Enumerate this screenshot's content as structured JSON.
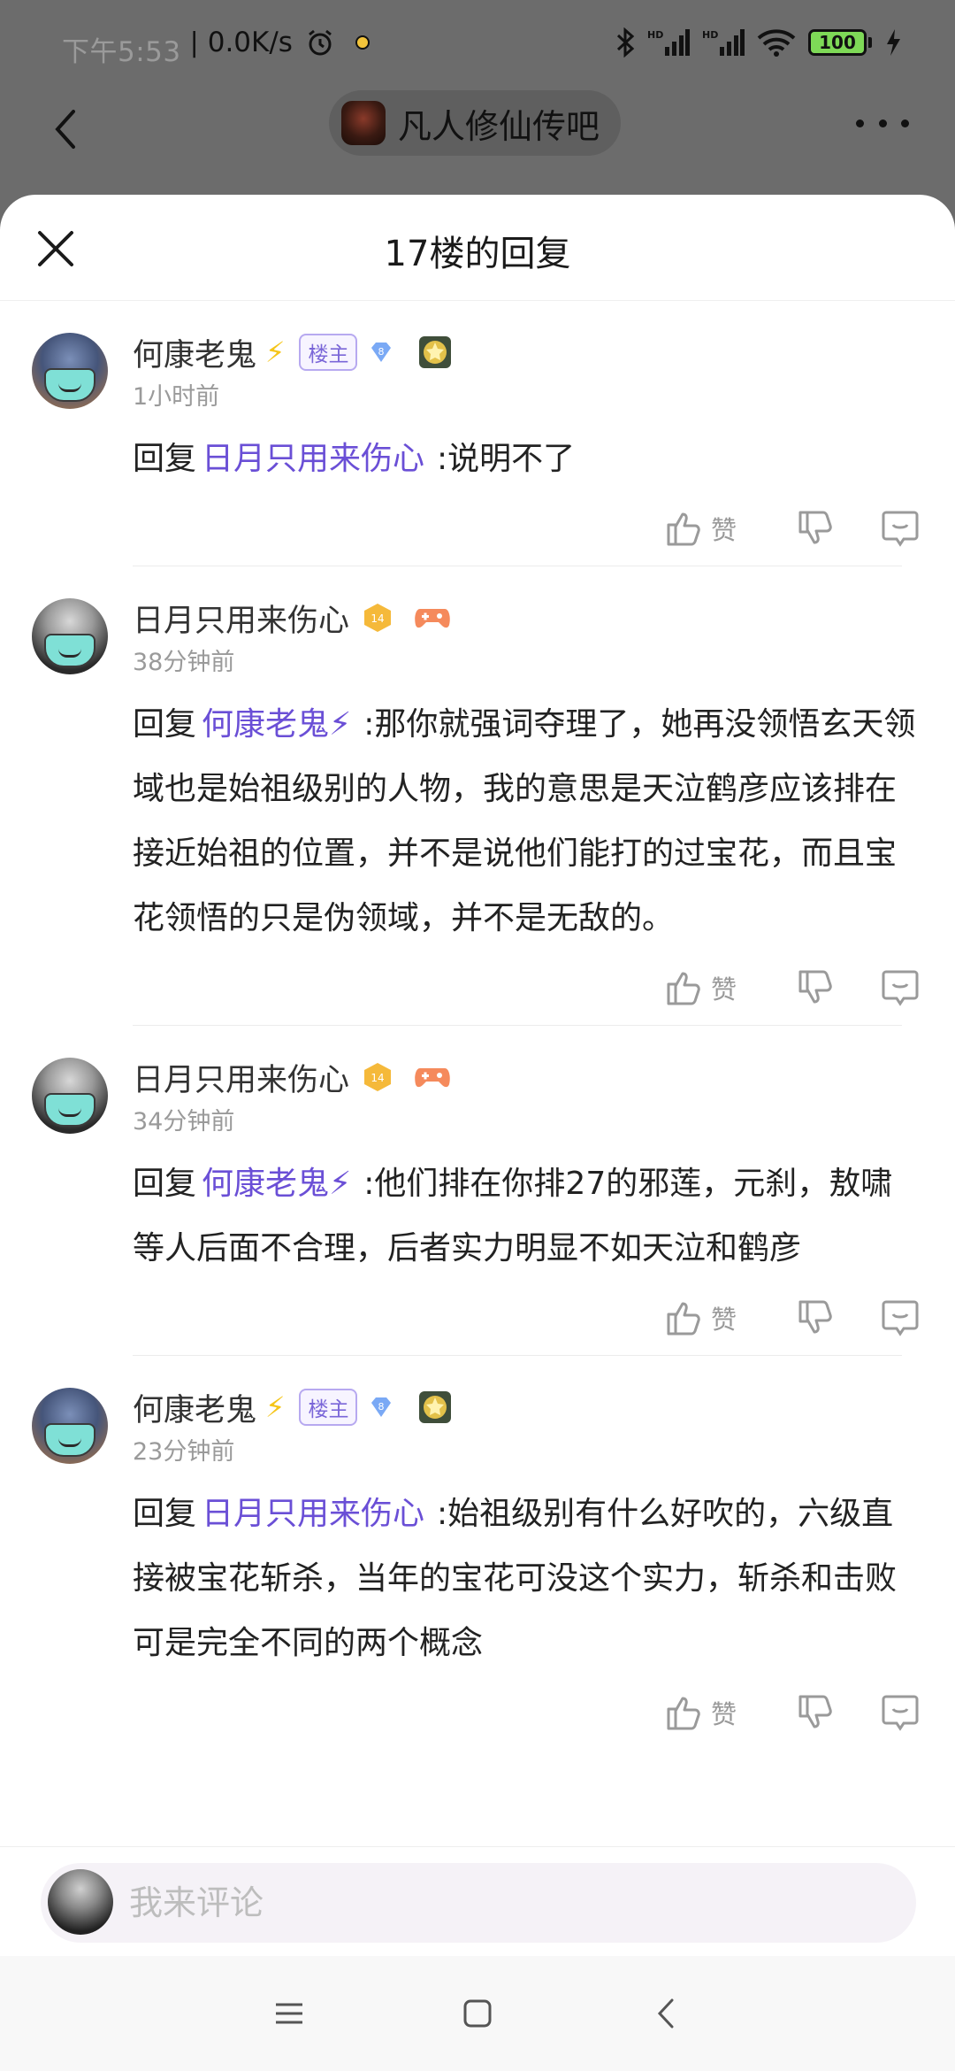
{
  "status_bar": {
    "time": "下午5:53",
    "separator": "|",
    "net_speed": "0.0K/s",
    "battery_level": "100",
    "battery_fraction": 1.0
  },
  "top_nav": {
    "forum_name": "凡人修仙传吧"
  },
  "sheet": {
    "title": "17楼的回复"
  },
  "reply_word": "回复",
  "like_label": "赞",
  "comments": [
    {
      "author": "何康老鬼",
      "owner_badge": "楼主",
      "time": "1小时前",
      "mention": "日月只用来伤心",
      "text": ":说明不了"
    },
    {
      "author": "日月只用来伤心",
      "level": "14",
      "time": "38分钟前",
      "mention": "何康老鬼⚡",
      "text": ":那你就强词夺理了，她再没领悟玄天领域也是始祖级别的人物，我的意思是天泣鹤彦应该排在接近始祖的位置，并不是说他们能打的过宝花，而且宝花领悟的只是伪领域，并不是无敌的。"
    },
    {
      "author": "日月只用来伤心",
      "level": "14",
      "time": "34分钟前",
      "mention": "何康老鬼⚡",
      "text": ":他们排在你排27的邪莲，元刹，敖啸等人后面不合理，后者实力明显不如天泣和鹤彦"
    },
    {
      "author": "何康老鬼",
      "owner_badge": "楼主",
      "time": "23分钟前",
      "mention": "日月只用来伤心",
      "text": ":始祖级别有什么好吹的，六级直接被宝花斩杀，当年的宝花可没这个实力，斩杀和击败可是完全不同的两个概念"
    }
  ],
  "input": {
    "placeholder": "我来评论"
  },
  "colors": {
    "accent": "#6a4fd6",
    "owner_badge": "#7a66d8",
    "bolt": "#f5c518",
    "mask": "#7fe0d6"
  }
}
